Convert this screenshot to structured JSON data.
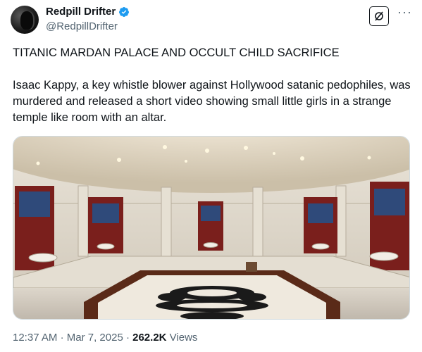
{
  "author": {
    "display_name": "Redpill Drifter",
    "handle": "@RedpillDrifter",
    "verified": true,
    "verified_color": "#1d9bf0"
  },
  "tweet": {
    "paragraphs": [
      "TITANIC MARDAN PALACE AND OCCULT CHILD SACRIFICE",
      "Isaac Kappy, a key whistle blower against Hollywood satanic pedophiles, was murdered and released a short video showing small little girls in a strange temple like room with an altar."
    ]
  },
  "meta": {
    "time": "12:37 AM",
    "date": "Mar 7, 2025",
    "views_count": "262.2K",
    "views_label": "Views",
    "separator": "·"
  },
  "icons": {
    "grok": "grok-icon",
    "more": "more-options-icon",
    "verified": "verified-badge-icon"
  }
}
